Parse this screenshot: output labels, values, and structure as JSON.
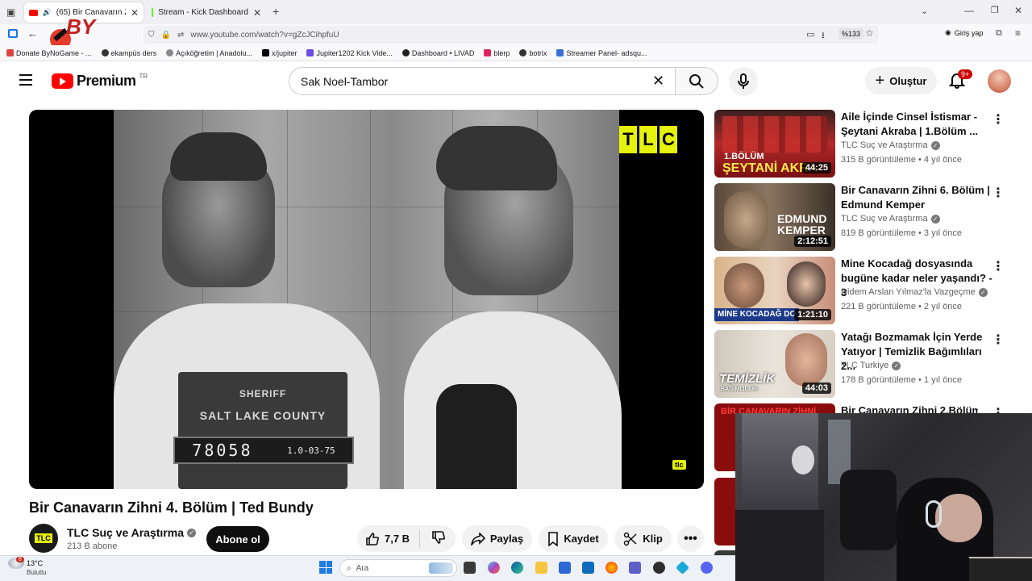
{
  "browser": {
    "tabs": [
      {
        "label": "(65) Bir Canavarın Zihni 4. B",
        "active": true
      },
      {
        "label": "Stream - Kick Dashboard",
        "active": false
      }
    ],
    "url": "www.youtube.com/watch?v=gZcJCihpfuU",
    "zoom": "%133",
    "signin": "Giriş yap",
    "bookmarks": [
      "Donate ByNoGame - ...",
      "ekampüs ders",
      "Açıköğretim | Anadolu...",
      "x/jupiter",
      "Jupiter1202 Kick Vide...",
      "Dashboard • LIVAD",
      "blerp",
      "botrix",
      "Streamer Panel- adsqu..."
    ],
    "overlay_logo": "BY"
  },
  "youtube": {
    "logo": "Premium",
    "logo_region": "TR",
    "search_value": "Sak Noel-Tambor",
    "create_label": "Oluştur",
    "notif_badge": "9+"
  },
  "video": {
    "title": "Bir Canavarın Zihni 4. Bölüm | Ted Bundy",
    "channel": "TLC Suç ve Araştırma",
    "subs": "213 B abone",
    "subscribe_label": "Abone ol",
    "likes": "7,7 B",
    "share_label": "Paylaş",
    "save_label": "Kaydet",
    "clip_label": "Klip",
    "watermark": "TLC",
    "corner_logo": "tlc",
    "plate_line1": "SHERIFF",
    "plate_line2": "SALT LAKE COUNTY",
    "plate_number": "78058",
    "plate_date": "1.0-03-75"
  },
  "related": [
    {
      "title": "Aile İçinde Cinsel İstismar - Şeytani Akraba | 1.Bölüm ...",
      "channel": "TLC Suç ve Araştırma",
      "meta": "315 B görüntüleme • 4 yıl önce",
      "duration": "44:25",
      "thumb_text": "1.BÖLÜM",
      "thumb_text2": "ŞEYTANİ AKRA"
    },
    {
      "title": "Bir Canavarın Zihni 6. Bölüm | Edmund Kemper",
      "channel": "TLC Suç ve Araştırma",
      "meta": "819 B görüntüleme • 3 yıl önce",
      "duration": "2:12:51",
      "thumb_text": "EDMUND",
      "thumb_text2": "KEMPER"
    },
    {
      "title": "Mine Kocadağ dosyasında bugüne kadar neler yaşandı? - 3",
      "channel": "Didem Arslan Yılmaz'la Vazgeçme",
      "meta": "221 B görüntüleme • 2 yıl önce",
      "duration": "1:21:10",
      "thumb_text": "MİNE KOCADAĞ DO",
      "thumb_text2": ""
    },
    {
      "title": "Yatağı Bozmamak İçin Yerde Yatıyor | Temizlik Bağımlıları 2...",
      "channel": "TLC Turkiye",
      "meta": "178 B görüntüleme • 1 yıl önce",
      "duration": "44:03",
      "thumb_text": "TEMİZLİK",
      "thumb_text2": "BAĞIMLILARI"
    },
    {
      "title": "Bir Canavarın Zihni 2.Bölüm |",
      "channel": "",
      "meta": "",
      "duration": "",
      "thumb_text": "BİR CANAVARIN ZİHNİ",
      "thumb_text2": ""
    }
  ],
  "taskbar": {
    "weather_temp": "13°C",
    "weather_desc": "Bulutlu",
    "weather_badge": "8",
    "search_placeholder": "Ara"
  }
}
